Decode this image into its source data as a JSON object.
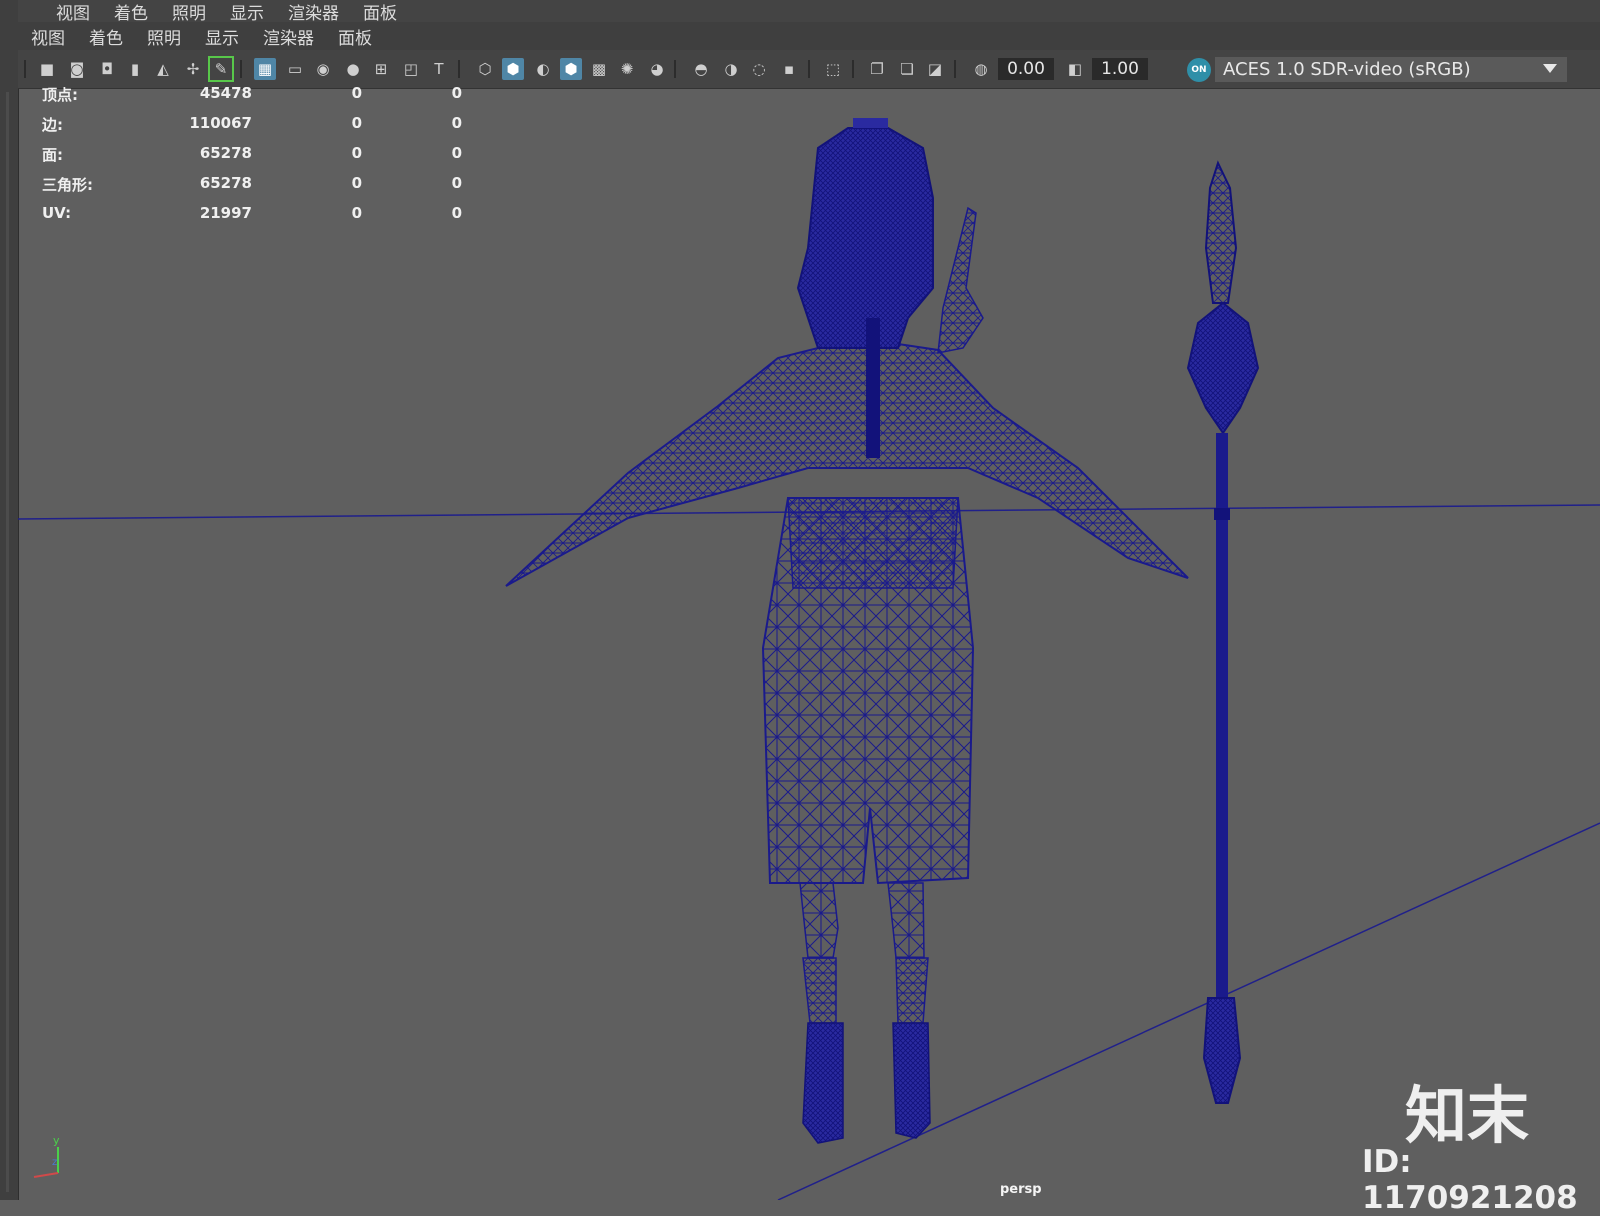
{
  "menus": {
    "top": [
      "视图",
      "着色",
      "照明",
      "显示",
      "渲染器",
      "面板"
    ],
    "panel": [
      "视图",
      "着色",
      "照明",
      "显示",
      "渲染器",
      "面板"
    ]
  },
  "toolbar": {
    "exposure": "0.00",
    "gamma": "1.00",
    "color_space": "ACES 1.0 SDR-video (sRGB)",
    "on_badge": "ON"
  },
  "hud": {
    "rows": [
      {
        "label": "顶点:",
        "v1": "45478",
        "v2": "0",
        "v3": "0"
      },
      {
        "label": "边:",
        "v1": "110067",
        "v2": "0",
        "v3": "0"
      },
      {
        "label": "面:",
        "v1": "65278",
        "v2": "0",
        "v3": "0"
      },
      {
        "label": "三角形:",
        "v1": "65278",
        "v2": "0",
        "v3": "0"
      },
      {
        "label": "UV:",
        "v1": "21997",
        "v2": "0",
        "v3": "0"
      }
    ]
  },
  "viewport": {
    "camera": "persp",
    "wireframe_color": "#1a1a8c",
    "background": "#5f5f5f"
  },
  "axis": {
    "y": "y",
    "z": "z"
  },
  "watermark": {
    "brand": "知末",
    "id": "ID: 1170921208"
  }
}
